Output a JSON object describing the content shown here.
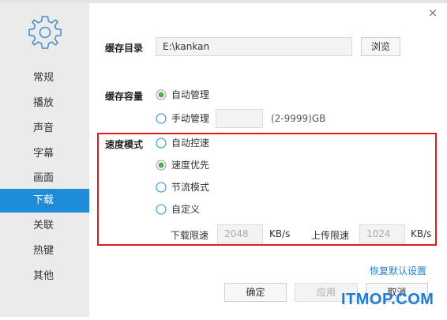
{
  "sidebar": {
    "items": [
      {
        "label": "常规"
      },
      {
        "label": "播放"
      },
      {
        "label": "声音"
      },
      {
        "label": "字幕"
      },
      {
        "label": "画面"
      },
      {
        "label": "下载",
        "active": true
      },
      {
        "label": "关联"
      },
      {
        "label": "热键"
      },
      {
        "label": "其他"
      }
    ]
  },
  "close_label": "×",
  "cache_dir": {
    "label": "缓存目录",
    "value": "E:\\kankan",
    "browse_label": "浏览"
  },
  "cache_size": {
    "label": "缓存容量",
    "auto_label": "自动管理",
    "manual_label": "手动管理",
    "manual_value": "",
    "range_hint": "(2-9999)GB",
    "selected": "auto"
  },
  "speed_mode": {
    "label": "速度模式",
    "options": [
      {
        "label": "自动控速",
        "selected": false
      },
      {
        "label": "速度优先",
        "selected": true
      },
      {
        "label": "节流模式",
        "selected": false
      },
      {
        "label": "自定义",
        "selected": false
      }
    ],
    "download_limit_label": "下载限速",
    "download_limit_value": "2048",
    "download_unit": "KB/s",
    "upload_limit_label": "上传限速",
    "upload_limit_value": "1024",
    "upload_unit": "KB/s"
  },
  "restore_defaults": "恢复默认设置",
  "buttons": {
    "ok": "确定",
    "apply": "应用",
    "cancel": "取消"
  },
  "watermark": "ITMOP.COM",
  "colors": {
    "accent": "#1e8cd8",
    "radio_selected": "#4caf50",
    "highlight_border": "#e11b22"
  }
}
